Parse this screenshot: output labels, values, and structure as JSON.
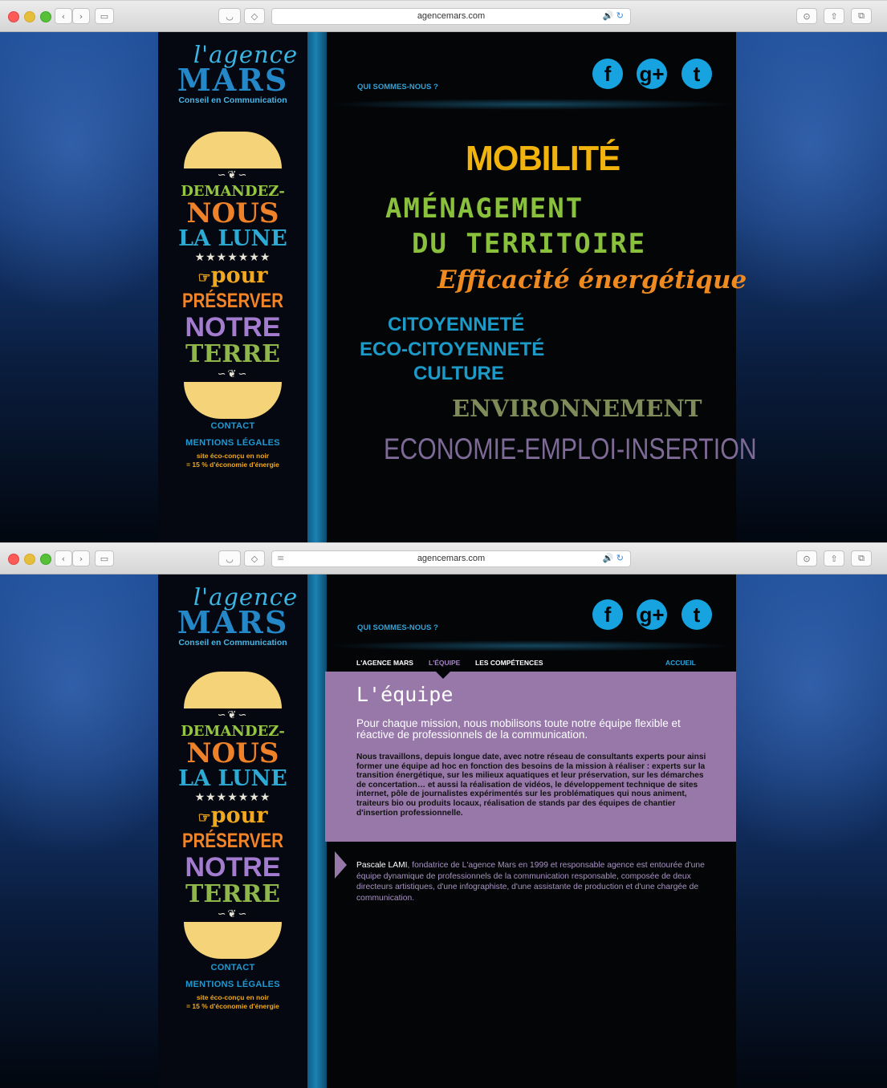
{
  "browser": {
    "url": "agencemars.com",
    "audio_icon": "🔊",
    "reload_icon": "↻"
  },
  "logo": {
    "line1": "l'agence",
    "line2": "MARS",
    "tagline": "Conseil en Communication"
  },
  "poster": {
    "line1": "DEMANDEZ-",
    "line2": "NOUS",
    "line3": "LA LUNE",
    "stars": "★★★★★★★",
    "line4": "pour",
    "line5": "PRÉSERVER",
    "line6": "NOTRE",
    "line7": "TERRE"
  },
  "sidebar": {
    "contact": "CONTACT",
    "mentions": "MENTIONS LÉGALES",
    "eco_line1": "site éco-conçu en noir",
    "eco_line2": "= 15 % d'économie d'énergie"
  },
  "header": {
    "qui": "QUI SOMMES-NOUS ?",
    "social": [
      {
        "icon": "facebook-icon",
        "glyph": "f"
      },
      {
        "icon": "google-plus-icon",
        "glyph": "g+"
      },
      {
        "icon": "twitter-icon",
        "glyph": "t"
      }
    ]
  },
  "keywords": {
    "mobilite": "MOBILITÉ",
    "amenagement1": "AMÉNAGEMENT",
    "amenagement2": "DU TERRITOIRE",
    "efficacite": "Efficacité énergétique",
    "citoyennete": "CITOYENNETÉ",
    "eco_citoyennete": "ECO-CITOYENNETÉ",
    "culture": "CULTURE",
    "environnement": "ENVIRONNEMENT",
    "economie": "ECONOMIE-EMPLOI-INSERTION"
  },
  "nav": {
    "agence": "L'AGENCE MARS",
    "equipe": "L'ÉQUIPE",
    "competences": "LES COMPÉTENCES",
    "accueil": "ACCUEIL"
  },
  "equipe": {
    "title": "L'équipe",
    "lead": "Pour chaque mission, nous mobilisons toute notre équipe flexible et réactive de professionnels de la communication.",
    "body": "Nous travaillons, depuis longue date, avec notre réseau de consultants experts pour ainsi former une équipe ad hoc en fonction des besoins de la mission à réaliser : experts sur la transition énergétique, sur les milieux aquatiques et leur préservation, sur les démarches de concertation… et aussi la réalisation de vidéos, le développement technique de sites internet, pôle de journalistes expérimentés sur les problématiques qui nous animent, traiteurs bio ou produits locaux, réalisation de stands par des équipes de chantier d'insertion professionnelle.",
    "pascale_name": "Pascale LAMI",
    "pascale_text": ", fondatrice de L'agence Mars en 1999 et responsable agence est entourée d'une équipe dynamique de professionnels de la communication responsable, composée de deux directeurs artistiques, d'une infographiste, d'une assistante de production et d'une chargée de communication."
  }
}
